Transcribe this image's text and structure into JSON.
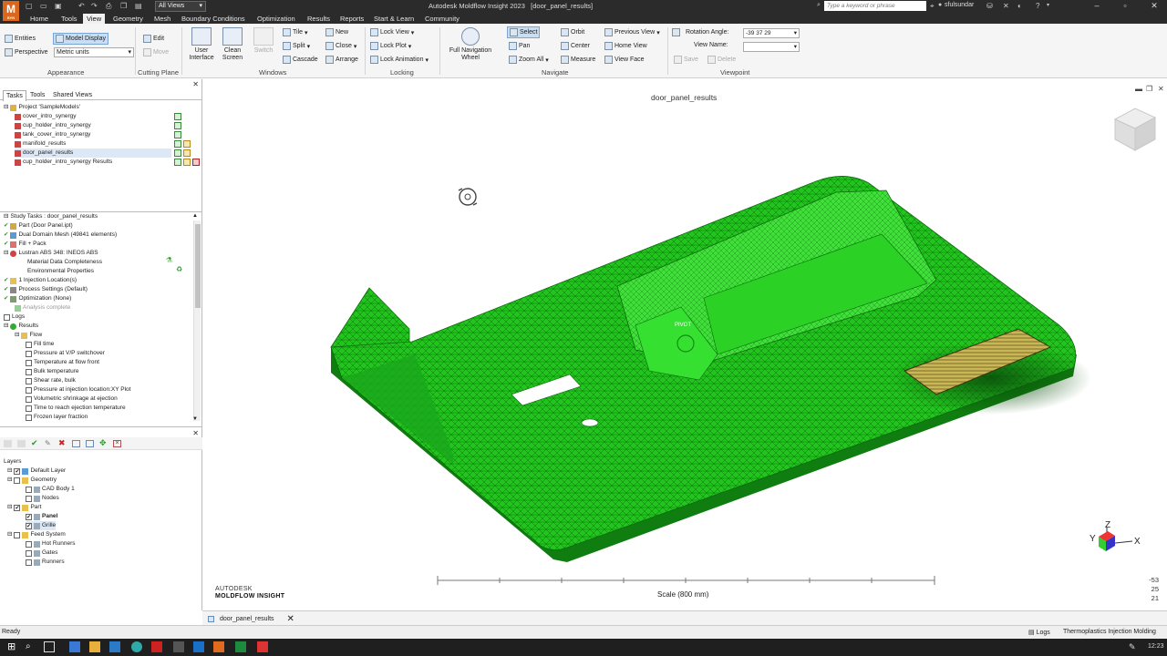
{
  "app": {
    "logo_letter": "M",
    "logo_sub": "SYN",
    "title": "Autodesk Moldflow Insight 2023",
    "document": "[door_panel_results]",
    "view_selector": "All Views",
    "search_placeholder": "Type a keyword or phrase",
    "user": "sfulsundar"
  },
  "menu": [
    "Home",
    "Tools",
    "View",
    "Geometry",
    "Mesh",
    "Boundary Conditions",
    "Optimization",
    "Results",
    "Reports",
    "Start & Learn",
    "Community"
  ],
  "menu_active": "View",
  "ribbon": {
    "appearance": {
      "label": "Appearance",
      "entities": "Entities",
      "model_display": "Model Display",
      "perspective": "Perspective",
      "units": "Metric units"
    },
    "cutting_plane": {
      "label": "Cutting Plane",
      "edit": "Edit",
      "move": "Move"
    },
    "windows": {
      "label": "Windows",
      "user_interface": "User\nInterface",
      "clean_screen": "Clean\nScreen",
      "switch": "Switch",
      "tile": "Tile",
      "split": "Split",
      "cascade": "Cascade",
      "new": "New",
      "close": "Close",
      "arrange": "Arrange"
    },
    "locking": {
      "label": "Locking",
      "lock_view": "Lock View",
      "lock_plot": "Lock Plot",
      "lock_animation": "Lock Animation"
    },
    "navigate": {
      "label": "Navigate",
      "full_nav": "Full Navigation\nWheel",
      "select": "Select",
      "pan": "Pan",
      "zoom_all": "Zoom All",
      "orbit": "Orbit",
      "center": "Center",
      "measure": "Measure",
      "previous_view": "Previous View",
      "home_view": "Home View",
      "view_face": "View Face"
    },
    "viewpoint": {
      "label": "Viewpoint",
      "rotation_angle_label": "Rotation Angle:",
      "rotation_angle_value": "-39 37 29",
      "view_name_label": "View Name:",
      "save": "Save",
      "delete": "Delete"
    }
  },
  "left_tabs": [
    "Tasks",
    "Tools",
    "Shared Views"
  ],
  "project": {
    "title": "Project 'SampleModels'",
    "items": [
      "cover_intro_synergy",
      "cup_holder_intro_synergy",
      "tank_cover_intro_synergy",
      "manifold_results",
      "door_panel_results",
      "cup_holder_intro_synergy Results"
    ],
    "selected": "door_panel_results"
  },
  "study": {
    "title": "Study Tasks : door_panel_results",
    "rows": [
      "Part (Door Panel.ipt)",
      "Dual Domain Mesh (49841 elements)",
      "Fill + Pack",
      "Lustran ABS 348: INEOS ABS",
      "Material Data Completeness",
      "Environmental Properties",
      "1 Injection Location(s)",
      "Process Settings (Default)",
      "Optimization (None)",
      "Analysis complete",
      "Logs",
      "Results",
      "Flow",
      "Fill time",
      "Pressure at V/P switchover",
      "Temperature at flow front",
      "Bulk temperature",
      "Shear rate, bulk",
      "Pressure at injection location:XY Plot",
      "Volumetric shrinkage at ejection",
      "Time to reach ejection temperature",
      "Frozen layer fraction"
    ]
  },
  "layers": {
    "title": "Layers",
    "rows": [
      "Default Layer",
      "Geometry",
      "CAD Body 1",
      "Nodes",
      "Part",
      "Panel",
      "Grille",
      "Feed System",
      "Hot Runners",
      "Gates",
      "Runners"
    ]
  },
  "viewport": {
    "study_title": "door_panel_results",
    "pivot_label": "PIVOT",
    "scale_label": "Scale (800 mm)",
    "brand_line1": "AUTODESK",
    "brand_line2": "MOLDFLOW INSIGHT",
    "axis_x": "X",
    "axis_y": "Y",
    "axis_z": "Z",
    "coords": [
      "-53",
      "25",
      "21"
    ],
    "mesh_color": "#22c41e",
    "grille_color": "#b0a040"
  },
  "doc_tab": "door_panel_results",
  "status": {
    "left": "Ready",
    "logs": "Logs",
    "product": "Thermoplastics Injection Molding"
  },
  "taskbar": {
    "time": "12:23"
  }
}
